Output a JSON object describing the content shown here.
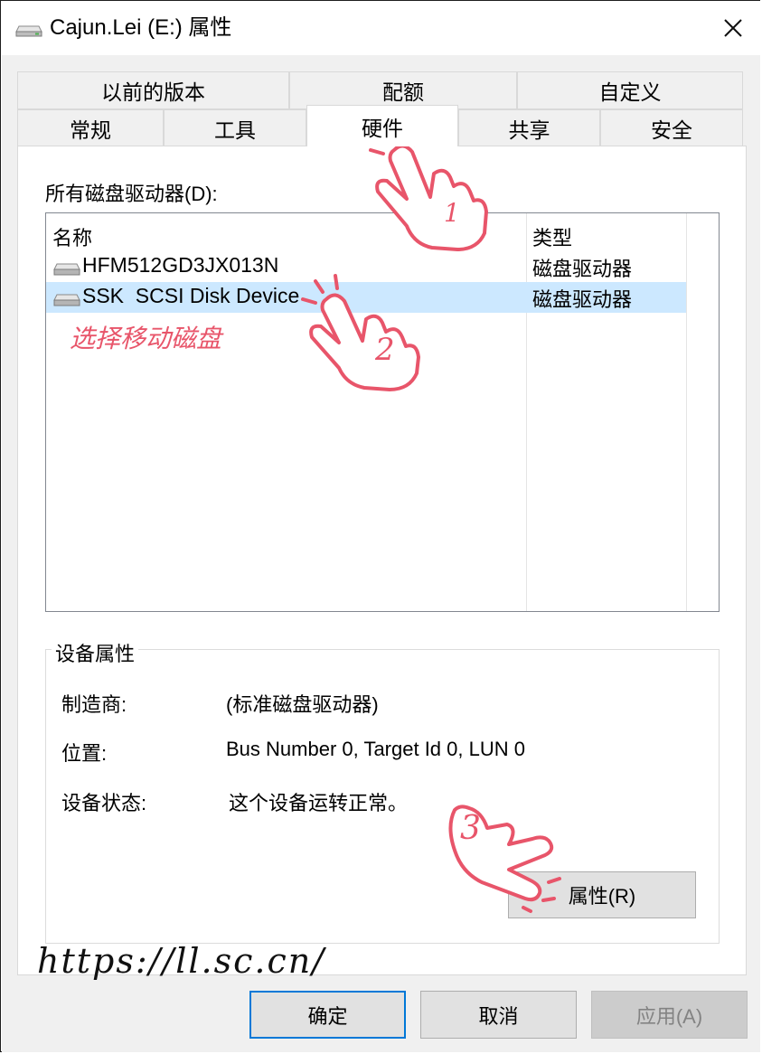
{
  "window": {
    "title": "Cajun.Lei (E:) 属性",
    "close_icon": "close-icon"
  },
  "tabs": {
    "row1": [
      "以前的版本",
      "配额",
      "自定义"
    ],
    "row2": [
      "常规",
      "工具",
      "硬件",
      "共享",
      "安全"
    ],
    "active": "硬件"
  },
  "hardware": {
    "drives_label": "所有磁盘驱动器(D):",
    "columns": {
      "name": "名称",
      "type": "类型"
    },
    "drives": [
      {
        "name": "HFM512GD3JX013N",
        "type": "磁盘驱动器",
        "selected": false
      },
      {
        "name": "SSK  SCSI Disk Device",
        "type": "磁盘驱动器",
        "selected": true
      }
    ],
    "device_properties": {
      "title": "设备属性",
      "manufacturer_label": "制造商:",
      "manufacturer_value": "(标准磁盘驱动器)",
      "location_label": "位置:",
      "location_value": "Bus Number 0, Target Id 0, LUN 0",
      "status_label": "设备状态:",
      "status_value": "这个设备运转正常。",
      "properties_button": "属性(R)"
    }
  },
  "buttons": {
    "ok": "确定",
    "cancel": "取消",
    "apply": "应用(A)"
  },
  "annotations": {
    "step1": "1",
    "step2": "2",
    "step3": "3",
    "note": "选择移动磁盘",
    "url": "https://ll.sc.cn/",
    "accent_color": "#e8556a"
  }
}
